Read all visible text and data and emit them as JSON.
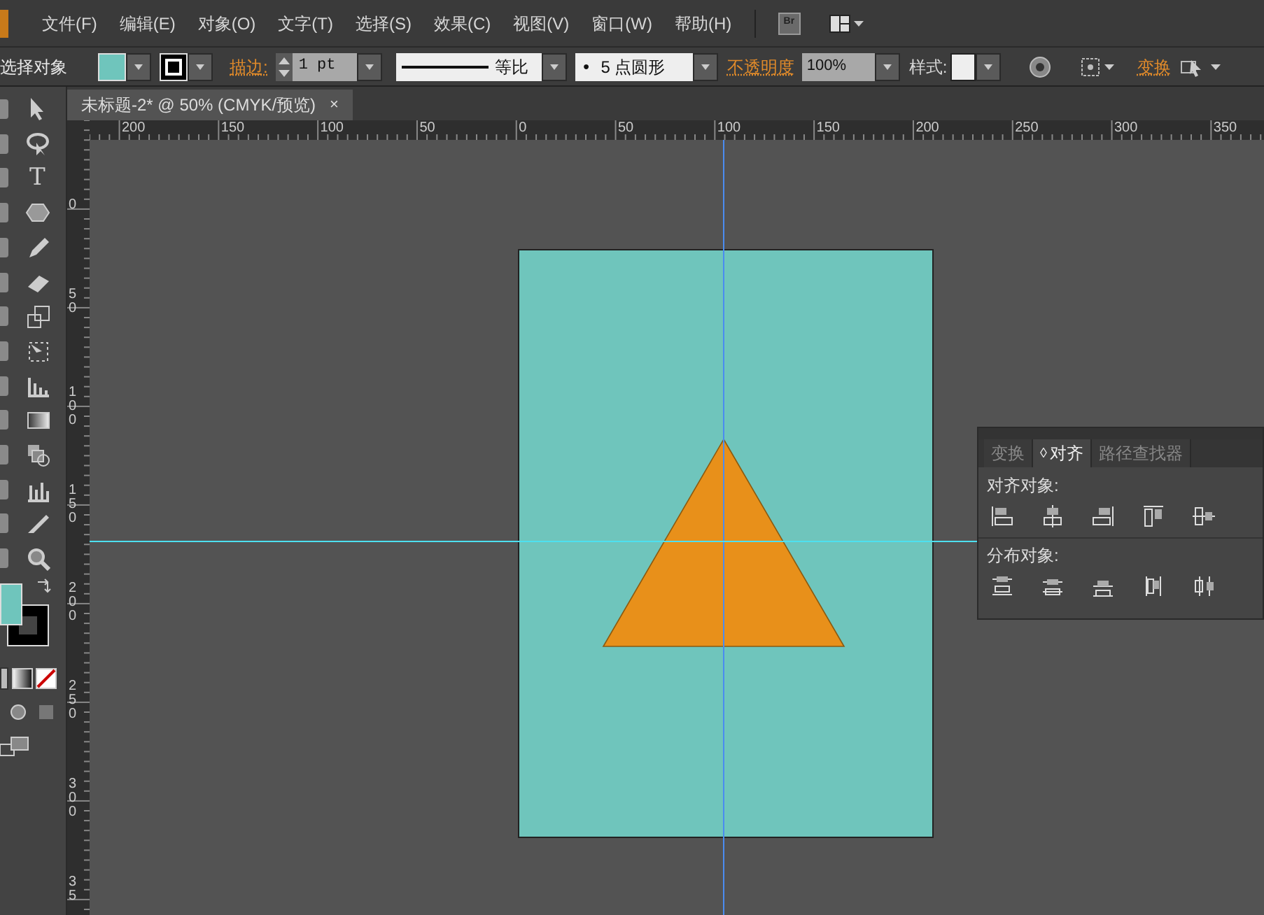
{
  "menu": [
    "文件(F)",
    "编辑(E)",
    "对象(O)",
    "文字(T)",
    "选择(S)",
    "效果(C)",
    "视图(V)",
    "窗口(W)",
    "帮助(H)"
  ],
  "bridge_button": "Br",
  "control_bar": {
    "selection_label": "选择对象",
    "stroke_label": "描边:",
    "stroke_weight": "1 pt",
    "stroke_profile": "等比",
    "brush_dot": "●",
    "brush": "5 点圆形",
    "opacity_label": "不透明度",
    "opacity": "100%",
    "style_label": "样式:",
    "transform_label": "变换"
  },
  "document_tab": {
    "title": "未标题-2* @ 50% (CMYK/预览)",
    "close": "×"
  },
  "rulers": {
    "horizontal": [
      "200",
      "150",
      "100",
      "50",
      "0",
      "50",
      "100",
      "150",
      "200",
      "250",
      "300",
      "350"
    ],
    "vertical": [
      "0",
      "50",
      "100",
      "150",
      "200",
      "250",
      "300",
      "35"
    ]
  },
  "tools": {
    "type_tool": "T"
  },
  "align_panel": {
    "tabs": [
      {
        "label": "变换",
        "selected": false
      },
      {
        "label": "对齐",
        "selected": true
      },
      {
        "label": "路径查找器",
        "selected": false
      }
    ],
    "selected_marker": "◊",
    "align_label": "对齐对象:",
    "distribute_label": "分布对象:"
  }
}
